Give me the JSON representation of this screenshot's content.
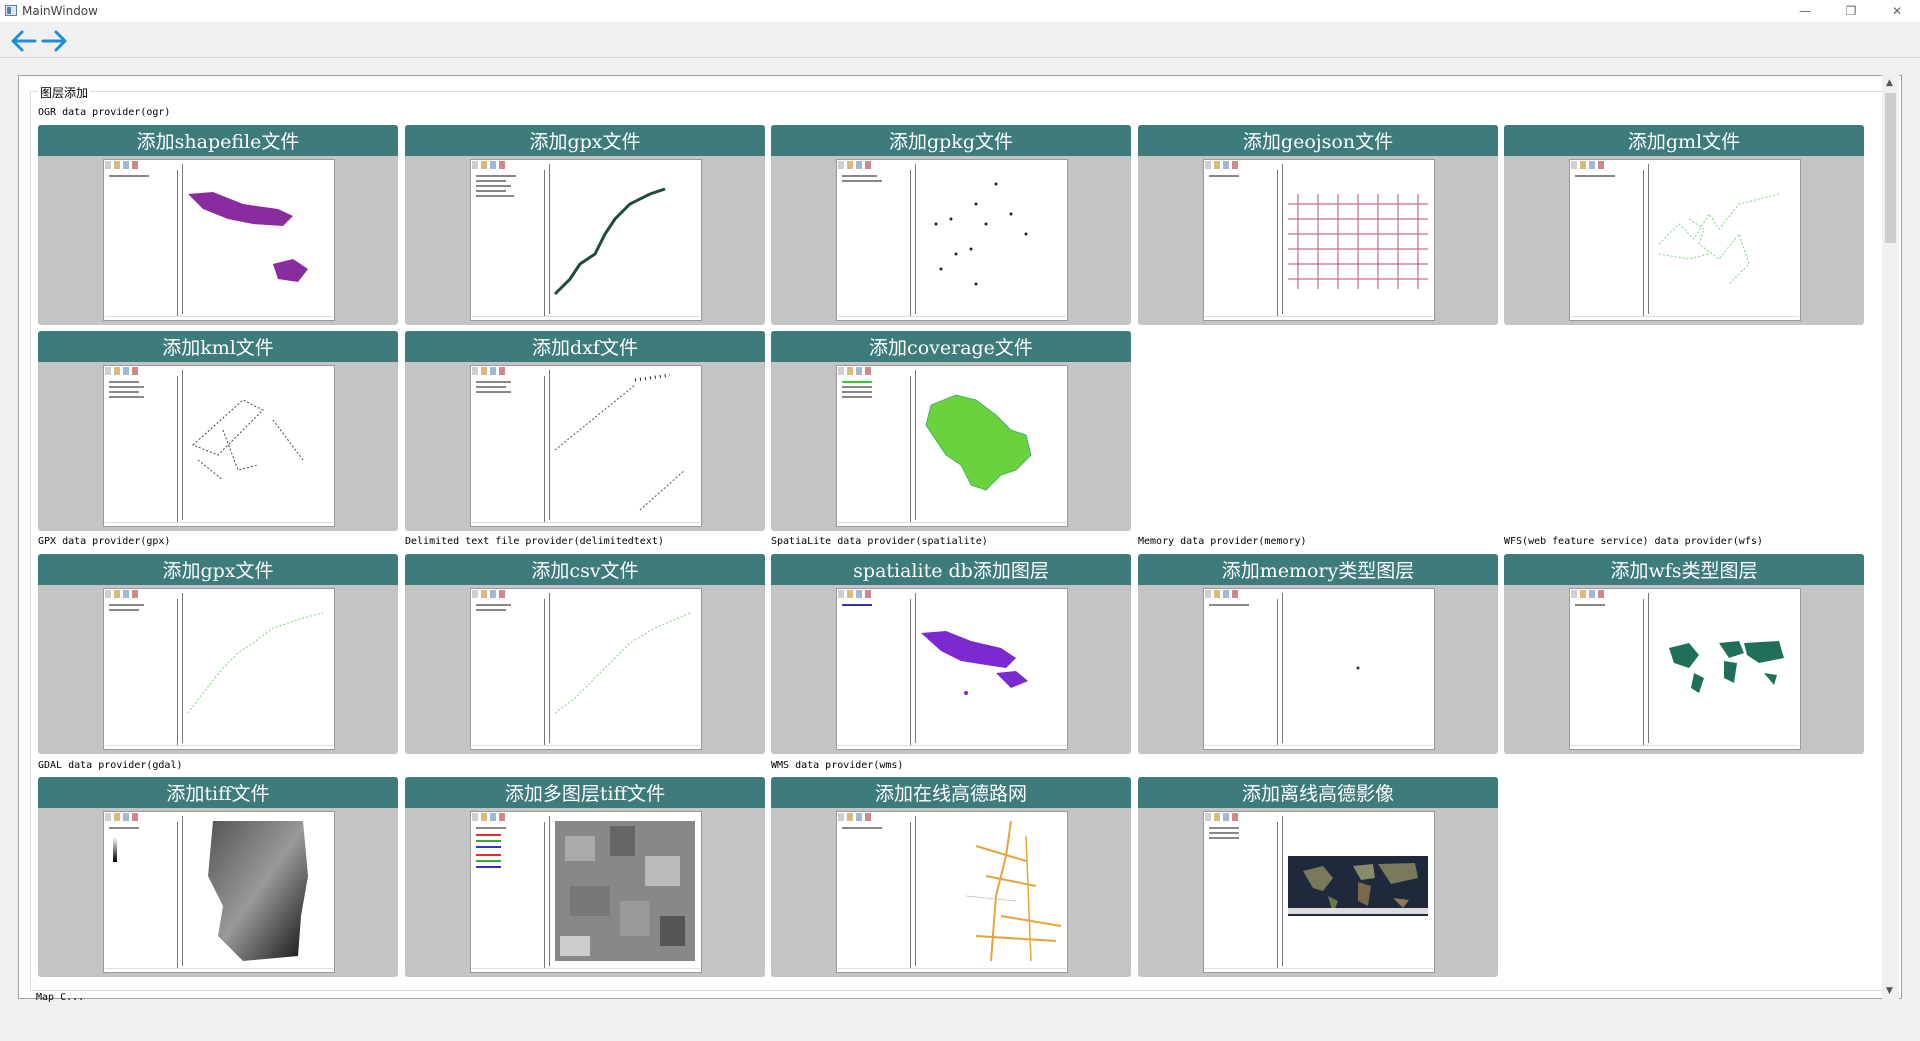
{
  "window": {
    "title": "MainWindow",
    "minimize": "—",
    "restore": "❐",
    "close": "✕"
  },
  "toolbar": {
    "back_icon": "arrow-left-icon",
    "forward_icon": "arrow-right-icon",
    "accent": "#1b8fd6"
  },
  "group": {
    "title": "图层添加"
  },
  "sections": {
    "ogr": "OGR data provider(ogr)",
    "gpx": "GPX data provider(gpx)",
    "delimited": "Delimited text file provider(delimitedtext)",
    "spatialite": "SpatiaLite data provider(spatialite)",
    "memory": "Memory data provider(memory)",
    "wfs": "WFS(web feature service) data provider(wfs)",
    "gdal": "GDAL data provider(gdal)",
    "wms": "WMS data provider(wms)"
  },
  "cards": {
    "shapefile": "添加shapefile文件",
    "gpx_ogr": "添加gpx文件",
    "gpkg": "添加gpkg文件",
    "geojson": "添加geojson文件",
    "gml": "添加gml文件",
    "kml": "添加kml文件",
    "dxf": "添加dxf文件",
    "coverage": "添加coverage文件",
    "gpx": "添加gpx文件",
    "csv": "添加csv文件",
    "spatialite": "spatialite db添加图层",
    "memory": "添加memory类型图层",
    "wfs": "添加wfs类型图层",
    "tiff": "添加tiff文件",
    "multitiff": "添加多图层tiff文件",
    "online_gaode": "添加在线高德路网",
    "offline_gaode": "添加离线高德影像"
  },
  "colors": {
    "card_header": "#3e7c7c",
    "card_bg": "#c4c4c4"
  },
  "bottom": {
    "label": "Map C..."
  }
}
